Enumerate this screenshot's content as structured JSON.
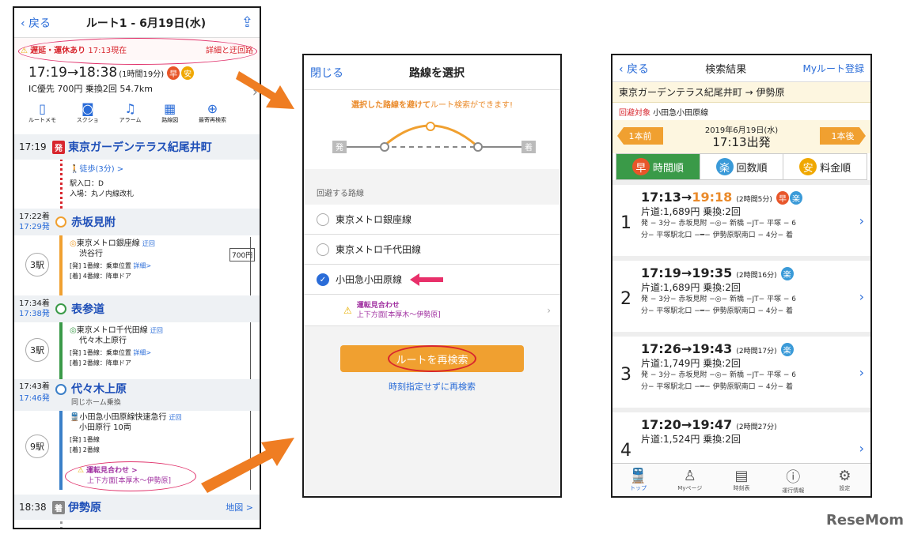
{
  "p1": {
    "back": "戻る",
    "title": "ルート1 - 6月19日(水)",
    "alert": "遅延・運休あり",
    "alert_time": "17:13現在",
    "alert_link": "詳細と迂回路",
    "time_range": "17:19→18:38",
    "duration": "(1時間19分)",
    "fare_line": "IC優先 700円 乗換2回 54.7km",
    "tools": [
      "ルートメモ",
      "スクショ",
      "アラーム",
      "路線図",
      "最寄再検索"
    ],
    "s1_time": "17:19",
    "s1_tag": "発",
    "s1_name": "東京ガーデンテラス紀尾井町",
    "walk": "徒歩(3分) >",
    "entrance": "駅入口：D",
    "entry": "入場：丸ノ内線改札",
    "s2_arr": "17:22着",
    "s2_dep": "17:29発",
    "s2_name": "赤坂見附",
    "l1_name": "東京メトロ銀座線",
    "l1_dir": "渋谷行",
    "l1_det1": "[発] 1番線：乗車位置",
    "l1_det2": "[着] 4番線：降車ドア",
    "l1_link": "詳細>",
    "stops1": "3駅",
    "fare": "700円",
    "s3_arr": "17:34着",
    "s3_dep": "17:38発",
    "s3_name": "表参道",
    "l2_name": "東京メトロ千代田線",
    "l2_dir": "代々木上原行",
    "l2_det1": "[発] 1番線：乗車位置",
    "l2_det2": "[着] 2番線：降車ドア",
    "l2_link": "詳細>",
    "stops2": "3駅",
    "s4_arr": "17:43着",
    "s4_dep": "17:46発",
    "s4_name": "代々木上原",
    "s4_sub": "同じホーム乗換",
    "l3_name": "小田急小田原線快速急行",
    "l3_dir": "小田原行 10両",
    "l3_det1": "[発] 1番線",
    "l3_det2": "[着] 2番線",
    "stops3": "9駅",
    "sus_title": "運転見合わせ >",
    "sus_sub": "上下方面[本厚木～伊勢原]",
    "s5_time": "18:38",
    "s5_tag": "着",
    "s5_name": "伊勢原",
    "map": "地図 >",
    "alt_label": "迂回",
    "same_label": "同じ"
  },
  "p2": {
    "close": "閉じる",
    "title": "路線を選択",
    "hint_a": "選択した路線を避けて",
    "hint_b": "ルート検索ができます!",
    "dep": "発",
    "arr": "着",
    "section": "回避する路線",
    "o1": "東京メトロ銀座線",
    "o2": "東京メトロ千代田線",
    "o3": "小田急小田原線",
    "sus_title": "運転見合わせ",
    "sus_sub": "上下方面[本厚木～伊勢原]",
    "research": "ルートを再検索",
    "research2": "時刻指定せずに再検索"
  },
  "p3": {
    "back": "戻る",
    "title": "検索結果",
    "myroute": "Myルート登録",
    "route": "東京ガーデンテラス紀尾井町 → 伊勢原",
    "avoid_label": "回避対象",
    "avoid_line": "小田急小田原線",
    "prev": "1本前",
    "next": "1本後",
    "date": "2019年6月19日(水)",
    "dep_time": "17:13出発",
    "tab1": "時間順",
    "tab2": "回数順",
    "tab3": "料金順",
    "tab1_ic": "早",
    "tab2_ic": "楽",
    "tab3_ic": "安",
    "results": [
      {
        "n": "1",
        "time": "17:13→",
        "arr": "19:18",
        "dur": "(2時間5分)",
        "fare": "片道:1,689円 乗換:2回",
        "d1": "発 − 3分− 赤坂見附 −◎− 新橋 −JT− 平塚 − 6",
        "d2": "分− 平塚駅北口 −━− 伊勢原駅南口 − 4分− 着"
      },
      {
        "n": "2",
        "time": "17:19→",
        "arr": "19:35",
        "dur": "(2時間16分)",
        "fare": "片道:1,689円 乗換:2回",
        "d1": "発 − 3分− 赤坂見附 −◎− 新橋 −JT− 平塚 − 6",
        "d2": "分− 平塚駅北口 −━− 伊勢原駅南口 − 4分− 着"
      },
      {
        "n": "3",
        "time": "17:26→",
        "arr": "19:43",
        "dur": "(2時間17分)",
        "fare": "片道:1,749円 乗換:2回",
        "d1": "発 − 3分− 赤坂見附 −◎− 新橋 −JT− 平塚 − 6",
        "d2": "分− 平塚駅北口 −━− 伊勢原駅南口 − 4分− 着"
      },
      {
        "n": "4",
        "time": "17:20→",
        "arr": "19:47",
        "dur": "(2時間27分)",
        "fare": "片道:1,524円 乗換:2回",
        "d1": "",
        "d2": ""
      }
    ],
    "footer": [
      "トップ",
      "Myページ",
      "時刻表",
      "運行情報",
      "設定"
    ]
  },
  "logo": "ReseMom"
}
